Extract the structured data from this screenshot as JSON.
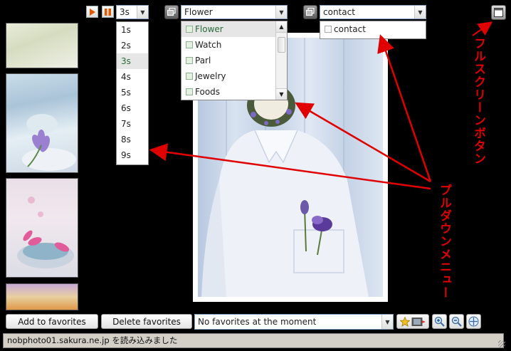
{
  "playback": {
    "interval_value": "3s",
    "interval_options": [
      "1s",
      "2s",
      "3s",
      "4s",
      "5s",
      "6s",
      "7s",
      "8s",
      "9s"
    ],
    "selected_index": 2
  },
  "category": {
    "value": "Flower",
    "options": [
      "Flower",
      "Watch",
      "Parl",
      "Jewelry",
      "Foods"
    ]
  },
  "page_menu": {
    "value": "contact",
    "options": [
      "contact"
    ]
  },
  "bottom": {
    "add_label": "Add to favorites",
    "delete_label": "Delete favorites",
    "favorites_value": "No favorites at the moment"
  },
  "status": {
    "text": "nobphoto01.sakura.ne.jp を読み込みました"
  },
  "annotations": {
    "fullscreen": "フルスクリーンボタン",
    "pulldown": "プルダウンメニュー"
  },
  "colors": {
    "annotation": "#e00000",
    "play_accent": "#e05a00"
  }
}
